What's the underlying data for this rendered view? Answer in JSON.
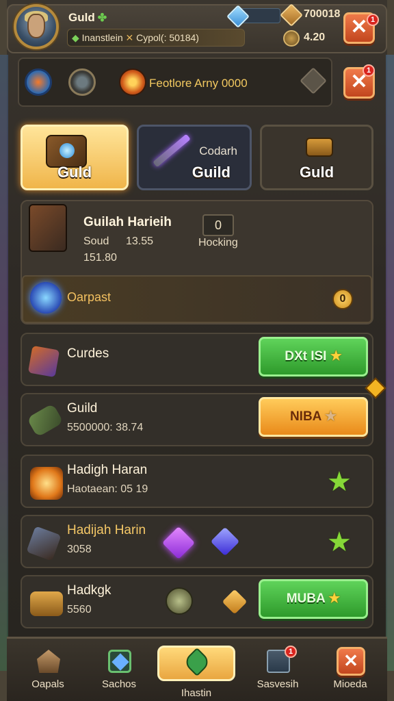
{
  "header": {
    "guild_name": "Guld",
    "subtitle": "Inanstlein",
    "subtitle_extra": "Cypol(: 50184)",
    "currency_1": "700018",
    "currency_2": "4.20",
    "close_badge": "1"
  },
  "toolbar": {
    "text": "Feotlore Arny 0000",
    "close_badge": "1"
  },
  "tabs": [
    {
      "label": "Guld",
      "sub": ""
    },
    {
      "label": "Guild",
      "sub": "Codarh"
    },
    {
      "label": "Guld",
      "sub": ""
    }
  ],
  "hero_card": {
    "title": "Guilah Harieih",
    "line1_a": "Soud",
    "line1_b": "13.55",
    "line2": "151.80",
    "stat_value": "0",
    "stat_label": "Hocking",
    "strip_label": "Oarpast",
    "strip_value": "0"
  },
  "rows": [
    {
      "title": "Curdes",
      "sub": "",
      "button": "DXt ISI"
    },
    {
      "title": "Guild",
      "sub": "5500000: 38.74",
      "button": "NIBA"
    },
    {
      "title": "Hadigh Haran",
      "sub": "Haotaean: 05 19",
      "button": ""
    },
    {
      "title": "Hadijah Harin",
      "sub": "3058",
      "button": ""
    },
    {
      "title": "Hadkgk",
      "sub": "5560",
      "button": "MUBA"
    }
  ],
  "bottom_nav": [
    {
      "label": "Oapals",
      "icon": "house-icon"
    },
    {
      "label": "Sachos",
      "icon": "gem-icon"
    },
    {
      "label": "Ihastin",
      "icon": "leaf-icon"
    },
    {
      "label": "Sasvesih",
      "icon": "book-icon",
      "badge": "1"
    },
    {
      "label": "Mioeda",
      "icon": "close-icon"
    }
  ],
  "colors": {
    "accent_gold": "#f0b54a",
    "button_green": "#2e9a2b",
    "button_orange": "#e98a1a",
    "close_red": "#c2461e"
  }
}
